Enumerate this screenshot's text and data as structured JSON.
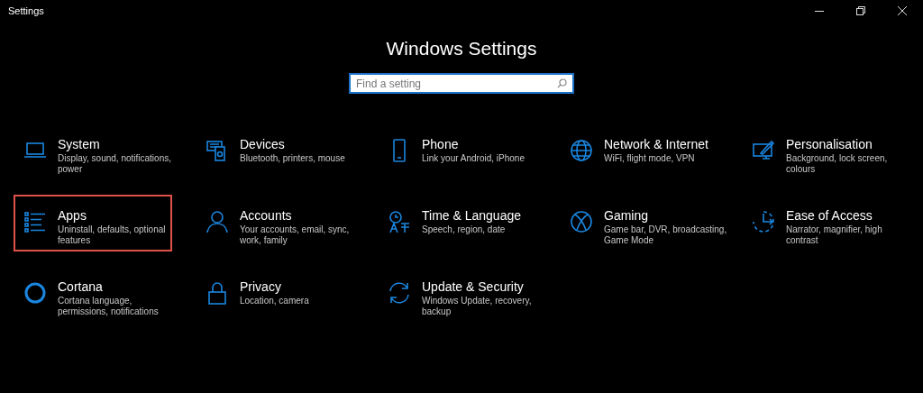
{
  "window": {
    "title": "Settings"
  },
  "heading": "Windows Settings",
  "search": {
    "placeholder": "Find a setting"
  },
  "items": [
    {
      "kind": "system",
      "title": "System",
      "subtitle": "Display, sound, notifications, power",
      "highlighted": false
    },
    {
      "kind": "devices",
      "title": "Devices",
      "subtitle": "Bluetooth, printers, mouse",
      "highlighted": false
    },
    {
      "kind": "phone",
      "title": "Phone",
      "subtitle": "Link your Android, iPhone",
      "highlighted": false
    },
    {
      "kind": "network",
      "title": "Network & Internet",
      "subtitle": "WiFi, flight mode, VPN",
      "highlighted": false
    },
    {
      "kind": "personalisation",
      "title": "Personalisation",
      "subtitle": "Background, lock screen, colours",
      "highlighted": false
    },
    {
      "kind": "apps",
      "title": "Apps",
      "subtitle": "Uninstall, defaults, optional features",
      "highlighted": true
    },
    {
      "kind": "accounts",
      "title": "Accounts",
      "subtitle": "Your accounts, email, sync, work, family",
      "highlighted": false
    },
    {
      "kind": "time",
      "title": "Time & Language",
      "subtitle": "Speech, region, date",
      "highlighted": false
    },
    {
      "kind": "gaming",
      "title": "Gaming",
      "subtitle": "Game bar, DVR, broadcasting, Game Mode",
      "highlighted": false
    },
    {
      "kind": "ease",
      "title": "Ease of Access",
      "subtitle": "Narrator, magnifier, high contrast",
      "highlighted": false
    },
    {
      "kind": "cortana",
      "title": "Cortana",
      "subtitle": "Cortana language, permissions, notifications",
      "highlighted": false
    },
    {
      "kind": "privacy",
      "title": "Privacy",
      "subtitle": "Location, camera",
      "highlighted": false
    },
    {
      "kind": "update",
      "title": "Update & Security",
      "subtitle": "Windows Update, recovery, backup",
      "highlighted": false
    }
  ]
}
